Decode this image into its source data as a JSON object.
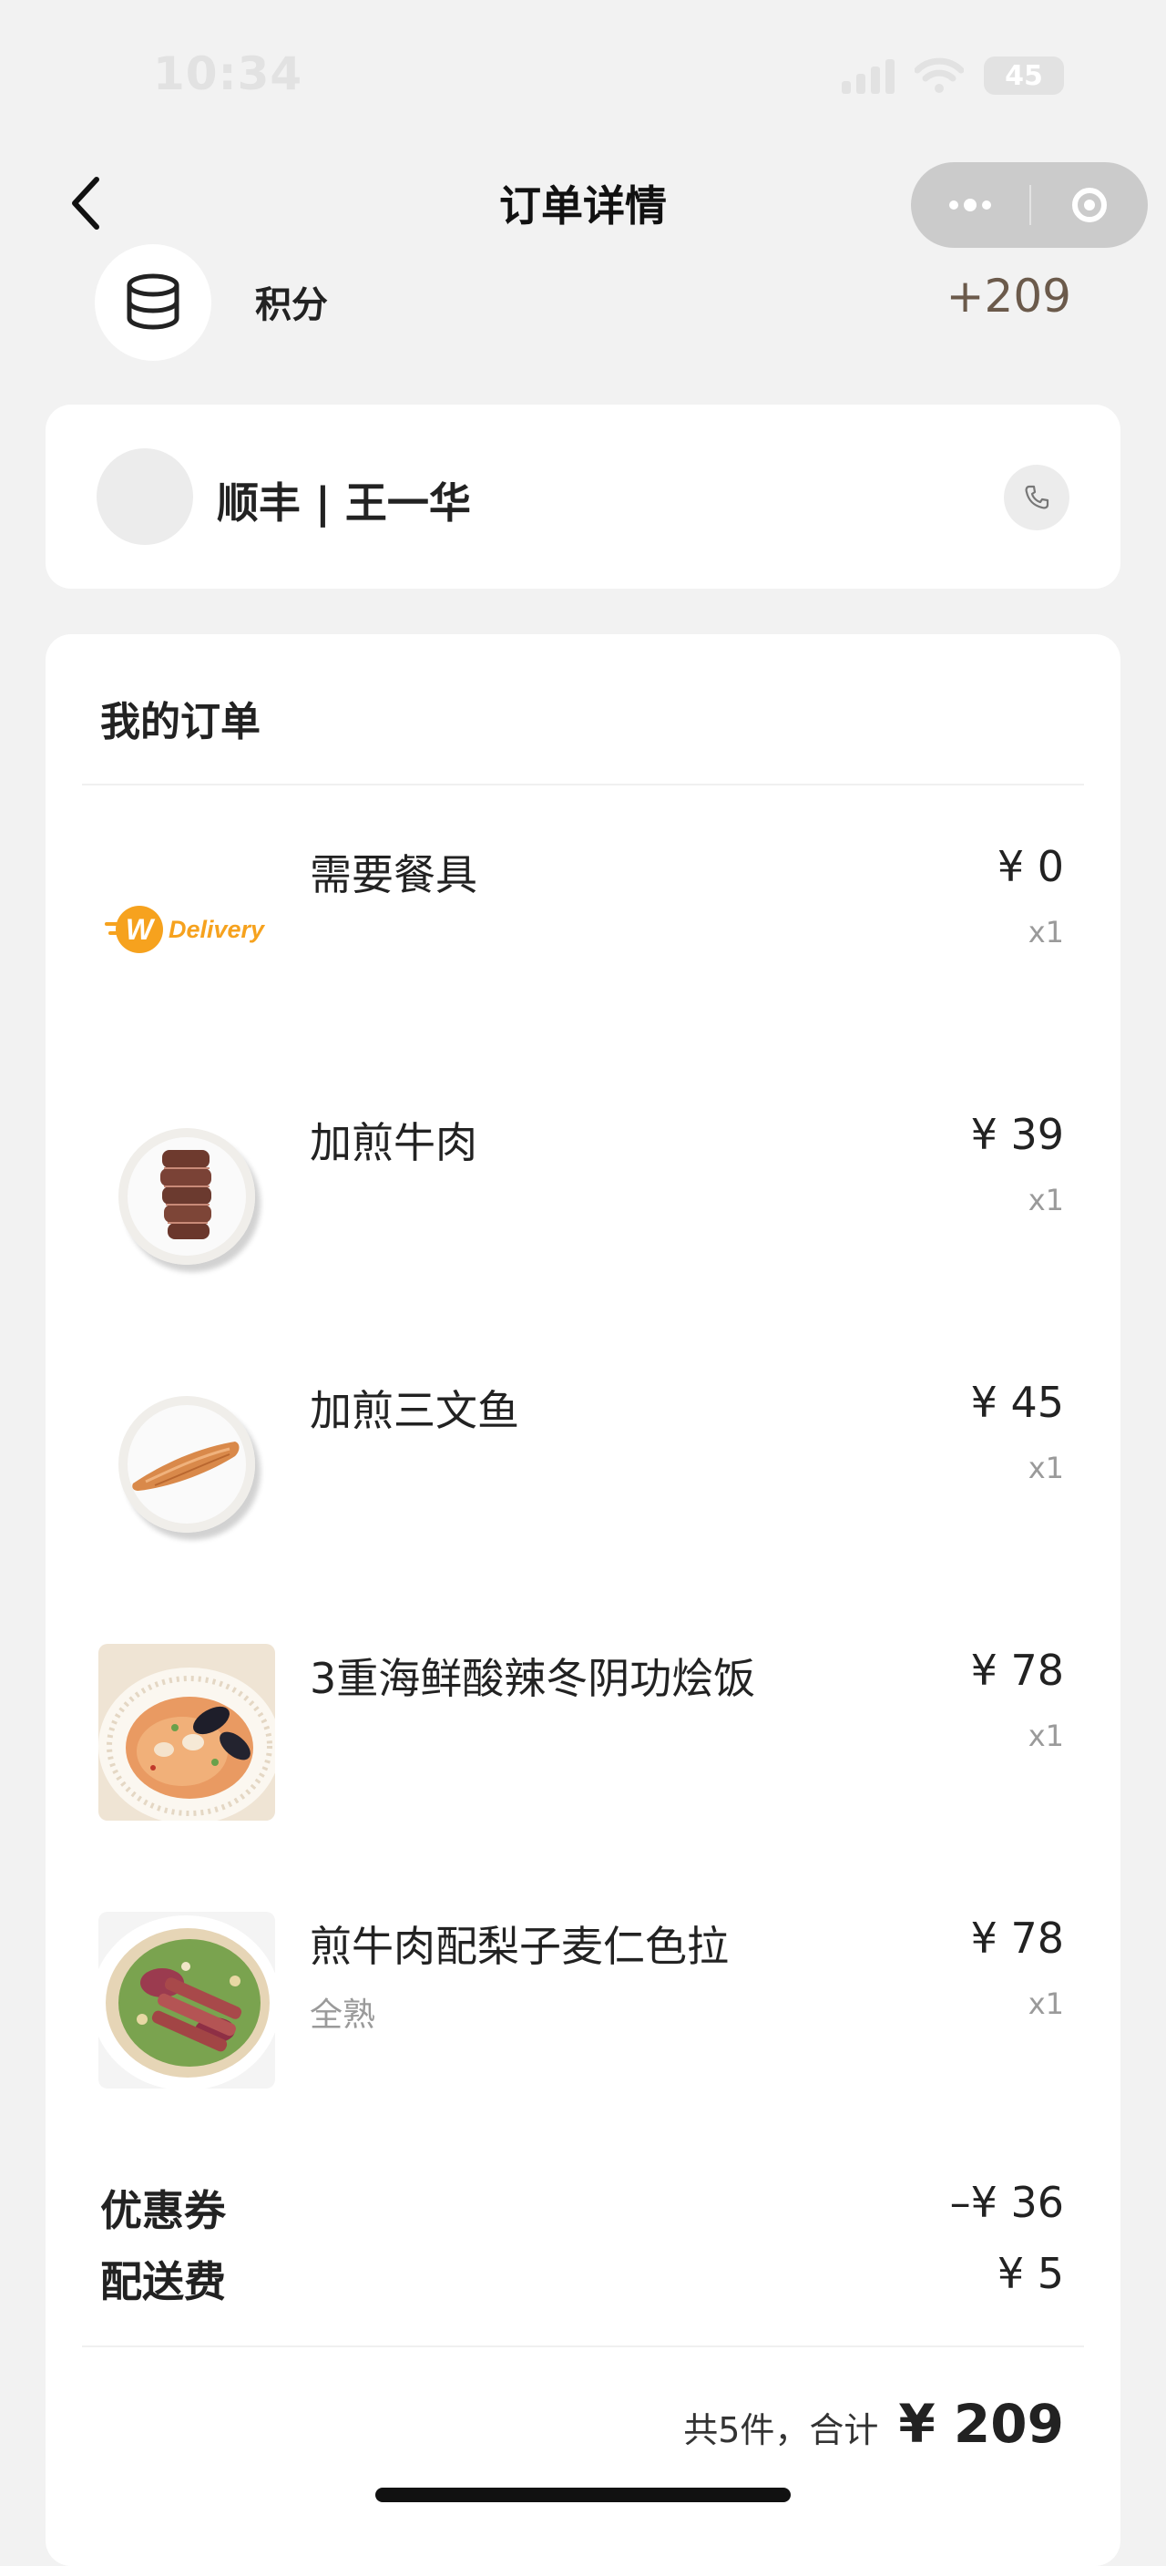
{
  "status_bar": {
    "time": "10:34",
    "battery": "45"
  },
  "nav": {
    "title": "订单详情"
  },
  "points": {
    "label": "积分",
    "value": "+209"
  },
  "courier": {
    "name": "顺丰 | 王一华"
  },
  "order": {
    "title": "我的订单",
    "items": [
      {
        "name": "需要餐具",
        "note": "",
        "price": "¥ 0",
        "qty": "x1",
        "image": "delivery-logo",
        "logo_text": "Delivery"
      },
      {
        "name": "加煎牛肉",
        "note": "",
        "price": "¥ 39",
        "qty": "x1",
        "image": "steak-plate"
      },
      {
        "name": "加煎三文鱼",
        "note": "",
        "price": "¥ 45",
        "qty": "x1",
        "image": "salmon-plate"
      },
      {
        "name": "3重海鲜酸辣冬阴功烩饭",
        "note": "",
        "price": "¥ 78",
        "qty": "x1",
        "image": "seafood-rice-bowl"
      },
      {
        "name": "煎牛肉配梨子麦仁色拉",
        "note": "全熟",
        "price": "¥ 78",
        "qty": "x1",
        "image": "beef-salad-bowl"
      }
    ],
    "coupon": {
      "label": "优惠券",
      "value": "–¥ 36"
    },
    "delivery_fee": {
      "label": "配送费",
      "value": "¥ 5"
    },
    "summary": {
      "count_text": "共5件，合计",
      "total": "¥ 209"
    }
  },
  "colors": {
    "points_value": "#6b5a4b",
    "brand_orange": "#f6a21e",
    "background": "#f2f2f2"
  }
}
